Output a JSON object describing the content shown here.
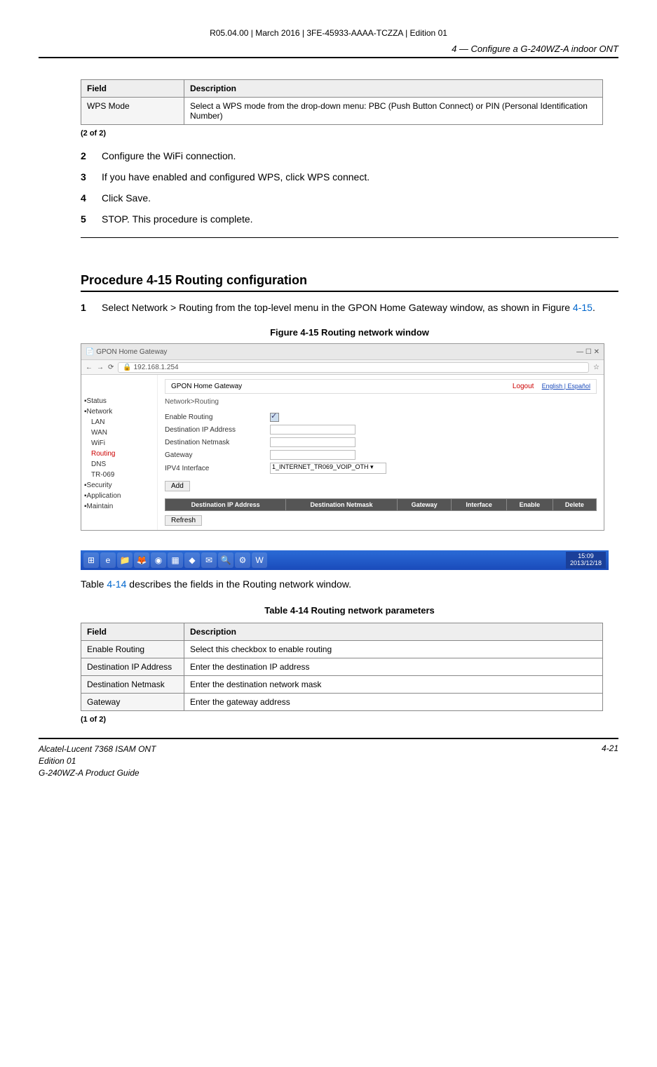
{
  "doc_header": "R05.04.00 | March 2016 | 3FE-45933-AAAA-TCZZA | Edition 01",
  "section_header": "4 —  Configure a G-240WZ-A indoor ONT",
  "table1": {
    "col1": "Field",
    "col2": "Description",
    "rows": [
      {
        "field": "WPS Mode",
        "desc": "Select a WPS mode from the drop-down menu: PBC (Push Button Connect) or PIN (Personal Identification Number)"
      }
    ],
    "note": "(2 of 2)"
  },
  "steps_a": [
    {
      "num": "2",
      "text": "Configure the WiFi connection."
    },
    {
      "num": "3",
      "text": "If you have enabled and configured WPS, click WPS connect."
    },
    {
      "num": "4",
      "text": "Click Save."
    },
    {
      "num": "5",
      "text": "STOP. This procedure is complete."
    }
  ],
  "proc_title": "Procedure 4-15  Routing configuration",
  "step_b": {
    "num": "1",
    "text_before": "Select Network > Routing from the top-level menu in the GPON Home Gateway window, as shown in Figure ",
    "fig_ref": "4-15",
    "text_after": "."
  },
  "fig_caption": "Figure 4-15  Routing network window",
  "screenshot": {
    "tab_title": "GPON Home Gateway",
    "address": "192.168.1.254",
    "header_title": "GPON Home Gateway",
    "logout": "Logout",
    "lang1": "English",
    "lang2": "Español",
    "breadcrumb": "Network>Routing",
    "sidebar": [
      "Status",
      "Network",
      "LAN",
      "WAN",
      "WiFi",
      "Routing",
      "DNS",
      "TR-069",
      "Security",
      "Application",
      "Maintain"
    ],
    "active_item": "Routing",
    "form": {
      "enable": "Enable Routing",
      "destip": "Destination IP Address",
      "destmask": "Destination Netmask",
      "gateway": "Gateway",
      "ipv4if": "IPV4 Interface",
      "ipv4val": "1_INTERNET_TR069_VOIP_OTH",
      "add": "Add"
    },
    "rt_cols": [
      "Destination IP Address",
      "Destination Netmask",
      "Gateway",
      "Interface",
      "Enable",
      "Delete"
    ],
    "refresh": "Refresh",
    "clock_time": "15:09",
    "clock_date": "2013/12/18"
  },
  "below_fig_before": "Table ",
  "below_fig_ref": "4-14",
  "below_fig_after": " describes the fields in the Routing network window.",
  "table2_caption": "Table 4-14 Routing network parameters",
  "table2": {
    "col1": "Field",
    "col2": "Description",
    "rows": [
      {
        "field": "Enable Routing",
        "desc": "Select this checkbox to enable routing"
      },
      {
        "field": "Destination IP Address",
        "desc": "Enter the destination IP address"
      },
      {
        "field": "Destination Netmask",
        "desc": "Enter the destination network mask"
      },
      {
        "field": "Gateway",
        "desc": "Enter the gateway address"
      }
    ],
    "note": "(1 of 2)"
  },
  "footer": {
    "l1": "Alcatel-Lucent 7368 ISAM ONT",
    "l2": "Edition 01",
    "l3": "G-240WZ-A Product Guide",
    "page": "4-21"
  }
}
